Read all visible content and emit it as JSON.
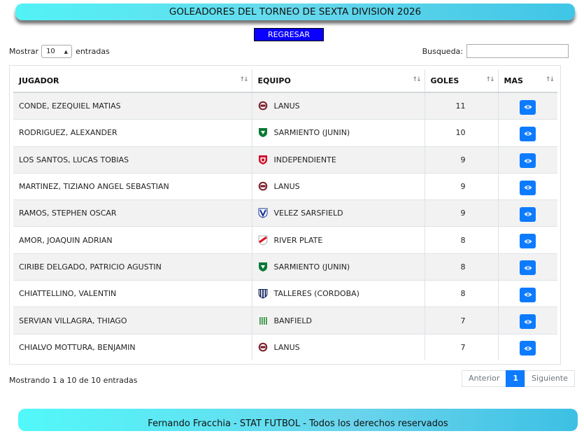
{
  "header": {
    "title": "GOLEADORES DEL TORNEO DE SEXTA DIVISION 2026",
    "back_label": "REGRESAR"
  },
  "controls": {
    "show_label": "Mostrar",
    "page_length": "10",
    "entries_label": "entradas",
    "search_label": "Busqueda:",
    "search_value": ""
  },
  "table": {
    "columns": [
      "JUGADOR",
      "EQUIPO",
      "GOLES",
      "MAS"
    ],
    "rows": [
      {
        "player": "CONDE, EZEQUIEL MATIAS",
        "team": "LANUS",
        "crest": "lanus",
        "goals": "11"
      },
      {
        "player": "RODRIGUEZ, ALEXANDER",
        "team": "SARMIENTO (JUNIN)",
        "crest": "sarmiento",
        "goals": "10"
      },
      {
        "player": "LOS SANTOS, LUCAS TOBIAS",
        "team": "INDEPENDIENTE",
        "crest": "independiente",
        "goals": "9"
      },
      {
        "player": "MARTINEZ, TIZIANO ANGEL SEBASTIAN",
        "team": "LANUS",
        "crest": "lanus",
        "goals": "9"
      },
      {
        "player": "RAMOS, STEPHEN OSCAR",
        "team": "VELEZ SARSFIELD",
        "crest": "velez",
        "goals": "9"
      },
      {
        "player": "AMOR, JOAQUIN ADRIAN",
        "team": "RIVER PLATE",
        "crest": "river",
        "goals": "8"
      },
      {
        "player": "CIRIBE DELGADO, PATRICIO AGUSTIN",
        "team": "SARMIENTO (JUNIN)",
        "crest": "sarmiento",
        "goals": "8"
      },
      {
        "player": "CHIATTELLINO, VALENTIN",
        "team": "TALLERES (CORDOBA)",
        "crest": "talleres",
        "goals": "8"
      },
      {
        "player": "SERVIAN VILLAGRA, THIAGO",
        "team": "BANFIELD",
        "crest": "banfield",
        "goals": "7"
      },
      {
        "player": "CHIALVO MOTTURA, BENJAMIN",
        "team": "LANUS",
        "crest": "lanus",
        "goals": "7"
      }
    ]
  },
  "footer_info": {
    "summary": "Mostrando 1 a 10 de 10 entradas"
  },
  "pagination": {
    "previous": "Anterior",
    "current": "1",
    "next": "Siguiente"
  },
  "footer": {
    "credit": "Fernando Fracchia - STAT FUTBOL - Todos los derechos reservados"
  },
  "colors": {
    "accent": "#0d7bff",
    "back_button": "#0a00ff",
    "banner": "#52f2f6"
  }
}
